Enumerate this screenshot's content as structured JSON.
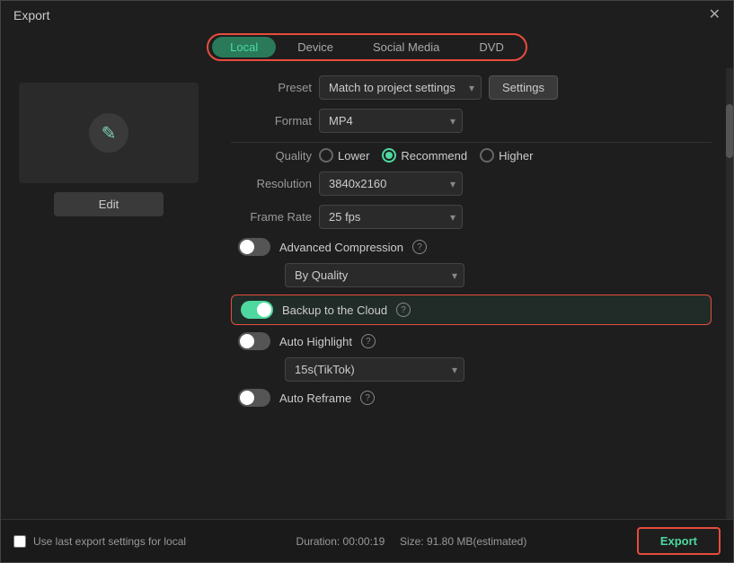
{
  "window": {
    "title": "Export",
    "close_label": "✕"
  },
  "tabs": [
    {
      "id": "local",
      "label": "Local",
      "active": true
    },
    {
      "id": "device",
      "label": "Device",
      "active": false
    },
    {
      "id": "social-media",
      "label": "Social Media",
      "active": false
    },
    {
      "id": "dvd",
      "label": "DVD",
      "active": false
    }
  ],
  "preview": {
    "edit_label": "Edit"
  },
  "settings": {
    "preset_label": "Preset",
    "preset_value": "Match to project settings",
    "settings_btn_label": "Settings",
    "format_label": "Format",
    "format_value": "MP4",
    "quality_label": "Quality",
    "quality_options": [
      {
        "id": "lower",
        "label": "Lower",
        "selected": false
      },
      {
        "id": "recommend",
        "label": "Recommend",
        "selected": true
      },
      {
        "id": "higher",
        "label": "Higher",
        "selected": false
      }
    ],
    "resolution_label": "Resolution",
    "resolution_value": "3840x2160",
    "framerate_label": "Frame Rate",
    "framerate_value": "25 fps",
    "advanced_compression_label": "Advanced Compression",
    "advanced_compression_on": false,
    "by_quality_value": "By Quality",
    "backup_cloud_label": "Backup to the Cloud",
    "backup_cloud_on": true,
    "auto_highlight_label": "Auto Highlight",
    "auto_highlight_on": false,
    "auto_highlight_sub": "15s(TikTok)",
    "auto_reframe_label": "Auto Reframe",
    "auto_reframe_on": false
  },
  "footer": {
    "checkbox_label": "Use last export settings for local",
    "duration_label": "Duration: 00:00:19",
    "size_label": "Size: 91.80 MB(estimated)",
    "export_label": "Export"
  },
  "icons": {
    "pencil": "✎",
    "question": "?",
    "chevron": "▾"
  }
}
